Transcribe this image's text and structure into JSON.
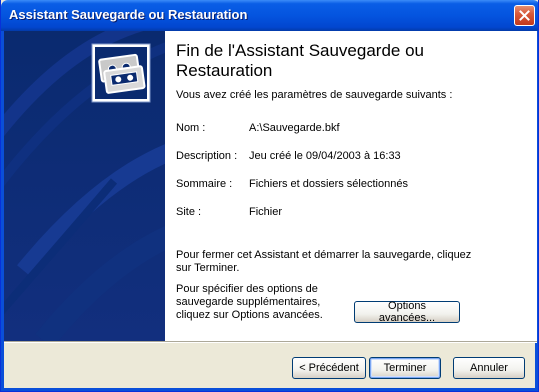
{
  "window": {
    "title": "Assistant Sauvegarde ou Restauration",
    "colors": {
      "titlebar": "#0454df",
      "side_panel": "#0a2a6f",
      "close_button": "#d85a3b",
      "dialog_bg": "#ece9d8"
    }
  },
  "side_panel": {
    "icon": "backup-tapes-icon"
  },
  "content": {
    "heading": "Fin de l'Assistant Sauvegarde ou Restauration",
    "intro": "Vous avez créé les paramètres de sauvegarde suivants :",
    "rows": [
      {
        "label": "Nom :",
        "value": "A:\\Sauvegarde.bkf"
      },
      {
        "label": "Description :",
        "value": "Jeu créé le 09/04/2003 à 16:33"
      },
      {
        "label": "Sommaire :",
        "value": "Fichiers et dossiers sélectionnés"
      },
      {
        "label": "Site :",
        "value": "Fichier"
      }
    ],
    "close_text": "Pour fermer cet Assistant et démarrer la sauvegarde, cliquez sur Terminer.",
    "options_text": "Pour spécifier des options de sauvegarde supplémentaires, cliquez sur Options avancées.",
    "options_button": "Options avancées..."
  },
  "buttons": {
    "back": "< Précédent",
    "finish": "Terminer",
    "cancel": "Annuler"
  }
}
